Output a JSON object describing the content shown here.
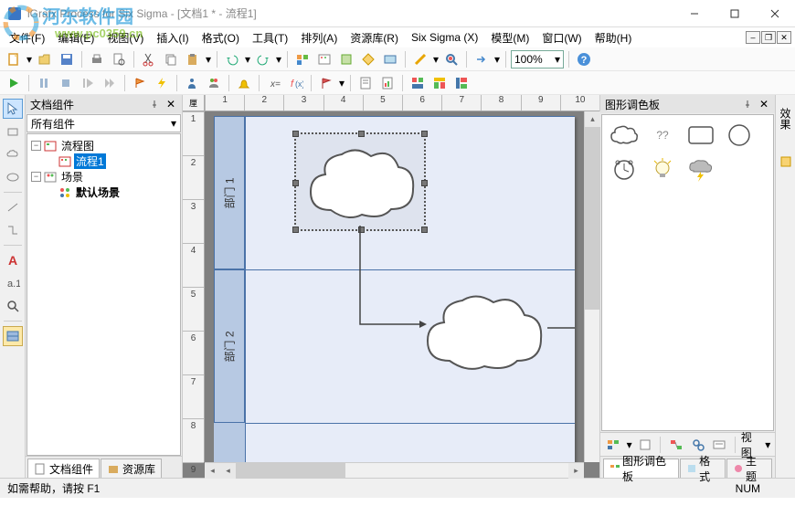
{
  "app": {
    "title": "iGrafx Process for Six Sigma - [文档1 * - 流程1]"
  },
  "watermark": {
    "main": "河东软件园",
    "sub": "www.pc0359.cn"
  },
  "menu": {
    "file": "文件(F)",
    "edit": "编辑(E)",
    "view": "视图(V)",
    "insert": "插入(I)",
    "format": "格式(O)",
    "tools": "工具(T)",
    "arrange": "排列(A)",
    "resource": "资源库(R)",
    "sixsigma": "Six Sigma  (X)",
    "model": "模型(M)",
    "window": "窗口(W)",
    "help": "帮助(H)"
  },
  "zoom": "100%",
  "left_panel": {
    "title": "文档组件",
    "combo": "所有组件",
    "tree": {
      "root1": "流程图",
      "node1": "流程1",
      "root2": "场景",
      "node2": "默认场景"
    },
    "tab1": "文档组件",
    "tab2": "资源库"
  },
  "ruler": {
    "unit": "厘",
    "h": [
      "1",
      "2",
      "3",
      "4",
      "5",
      "6",
      "7",
      "8",
      "9",
      "10"
    ],
    "v": [
      "1",
      "2",
      "3",
      "4",
      "5",
      "6",
      "7",
      "8",
      "9"
    ]
  },
  "lanes": {
    "lane1": "部门 1",
    "lane2": "部门 2"
  },
  "right_panel": {
    "title": "图形调色板",
    "view_label": "视图",
    "tab1": "图形调色板",
    "tab2": "格式",
    "tab3": "主题"
  },
  "right_vtab": {
    "tab1": "效果"
  },
  "palette": {
    "qq": "??"
  },
  "status": {
    "help": "如需帮助，请按 F1",
    "num": "NUM"
  }
}
